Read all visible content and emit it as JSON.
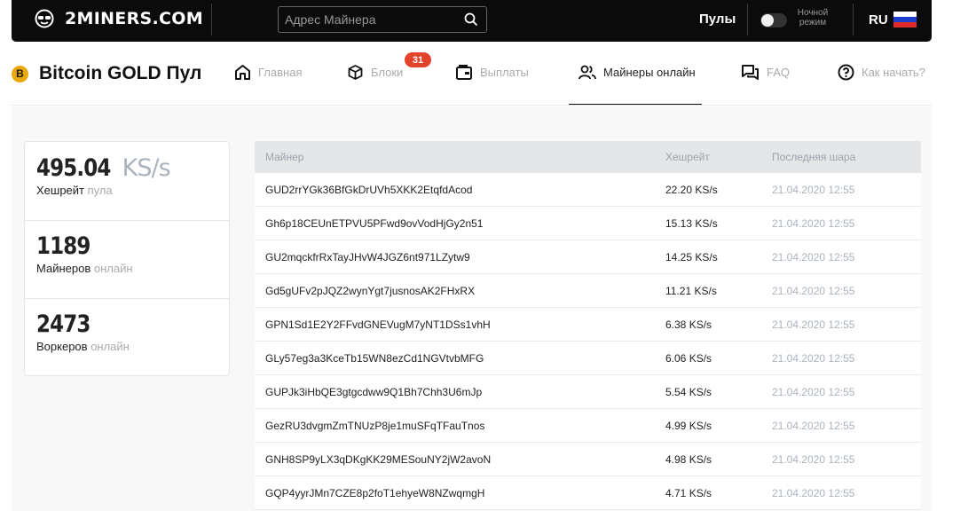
{
  "topbar": {
    "logo_text": "2MINERS.COM",
    "search_placeholder": "Адрес Майнера",
    "pools_label": "Пулы",
    "night_mode_line1": "Ночной",
    "night_mode_line2": "режим",
    "lang": "RU"
  },
  "subnav": {
    "pool_name": "Bitcoin GOLD Пул",
    "pool_logo_letter": "B",
    "items": [
      {
        "label": "Главная",
        "icon": "home-icon"
      },
      {
        "label": "Блоки",
        "icon": "cube-icon",
        "badge": "31"
      },
      {
        "label": "Выплаты",
        "icon": "wallet-icon"
      },
      {
        "label": "Майнеры онлайн",
        "icon": "users-icon",
        "active": true
      },
      {
        "label": "FAQ",
        "icon": "chat-icon"
      },
      {
        "label": "Как начать?",
        "icon": "help-icon"
      }
    ]
  },
  "stats": [
    {
      "value": "495.04",
      "unit": "KS/s",
      "label": "Хешрейт",
      "label_muted": "пула"
    },
    {
      "value": "1189",
      "unit": "",
      "label": "Майнеров",
      "label_muted": "онлайн"
    },
    {
      "value": "2473",
      "unit": "",
      "label": "Воркеров",
      "label_muted": "онлайн"
    }
  ],
  "table": {
    "headers": [
      "Майнер",
      "Хешрейт",
      "Последняя шара"
    ],
    "rows": [
      [
        "GUD2rrYGk36BfGkDrUVh5XKK2EtqfdAcod",
        "22.20 KS/s",
        "21.04.2020 12:55"
      ],
      [
        "Gh6p18CEUnETPVU5PFwd9ovVodHjGy2n51",
        "15.13 KS/s",
        "21.04.2020 12:55"
      ],
      [
        "GU2mqckfrRxTayJHvW4JGZ6nt971LZytw9",
        "14.25 KS/s",
        "21.04.2020 12:55"
      ],
      [
        "Gd5gUFv2pJQZ2wynYgt7jusnosAK2FHxRX",
        "11.21 KS/s",
        "21.04.2020 12:55"
      ],
      [
        "GPN1Sd1E2Y2FFvdGNEVugM7yNT1DSs1vhH",
        "6.38 KS/s",
        "21.04.2020 12:55"
      ],
      [
        "GLy57eg3a3KceTb15WN8ezCd1NGVtvbMFG",
        "6.06 KS/s",
        "21.04.2020 12:55"
      ],
      [
        "GUPJk3iHbQE3gtgcdww9Q1Bh7Chh3U6mJp",
        "5.54 KS/s",
        "21.04.2020 12:55"
      ],
      [
        "GezRU3dvgmZmTNUzP8je1muSFqTFauTnos",
        "4.99 KS/s",
        "21.04.2020 12:55"
      ],
      [
        "GNH8SP9yLX3qDKgKK29MESouNY2jW2avoN",
        "4.98 KS/s",
        "21.04.2020 12:55"
      ],
      [
        "GQP4yyrJMn7CZE8p2foT1ehyeW8NZwqmgH",
        "4.71 KS/s",
        "21.04.2020 12:55"
      ]
    ]
  },
  "colors": {
    "accent_badge": "#e2432a",
    "btg_gold": "#eba809",
    "topbar_bg": "#0b0b0b"
  }
}
